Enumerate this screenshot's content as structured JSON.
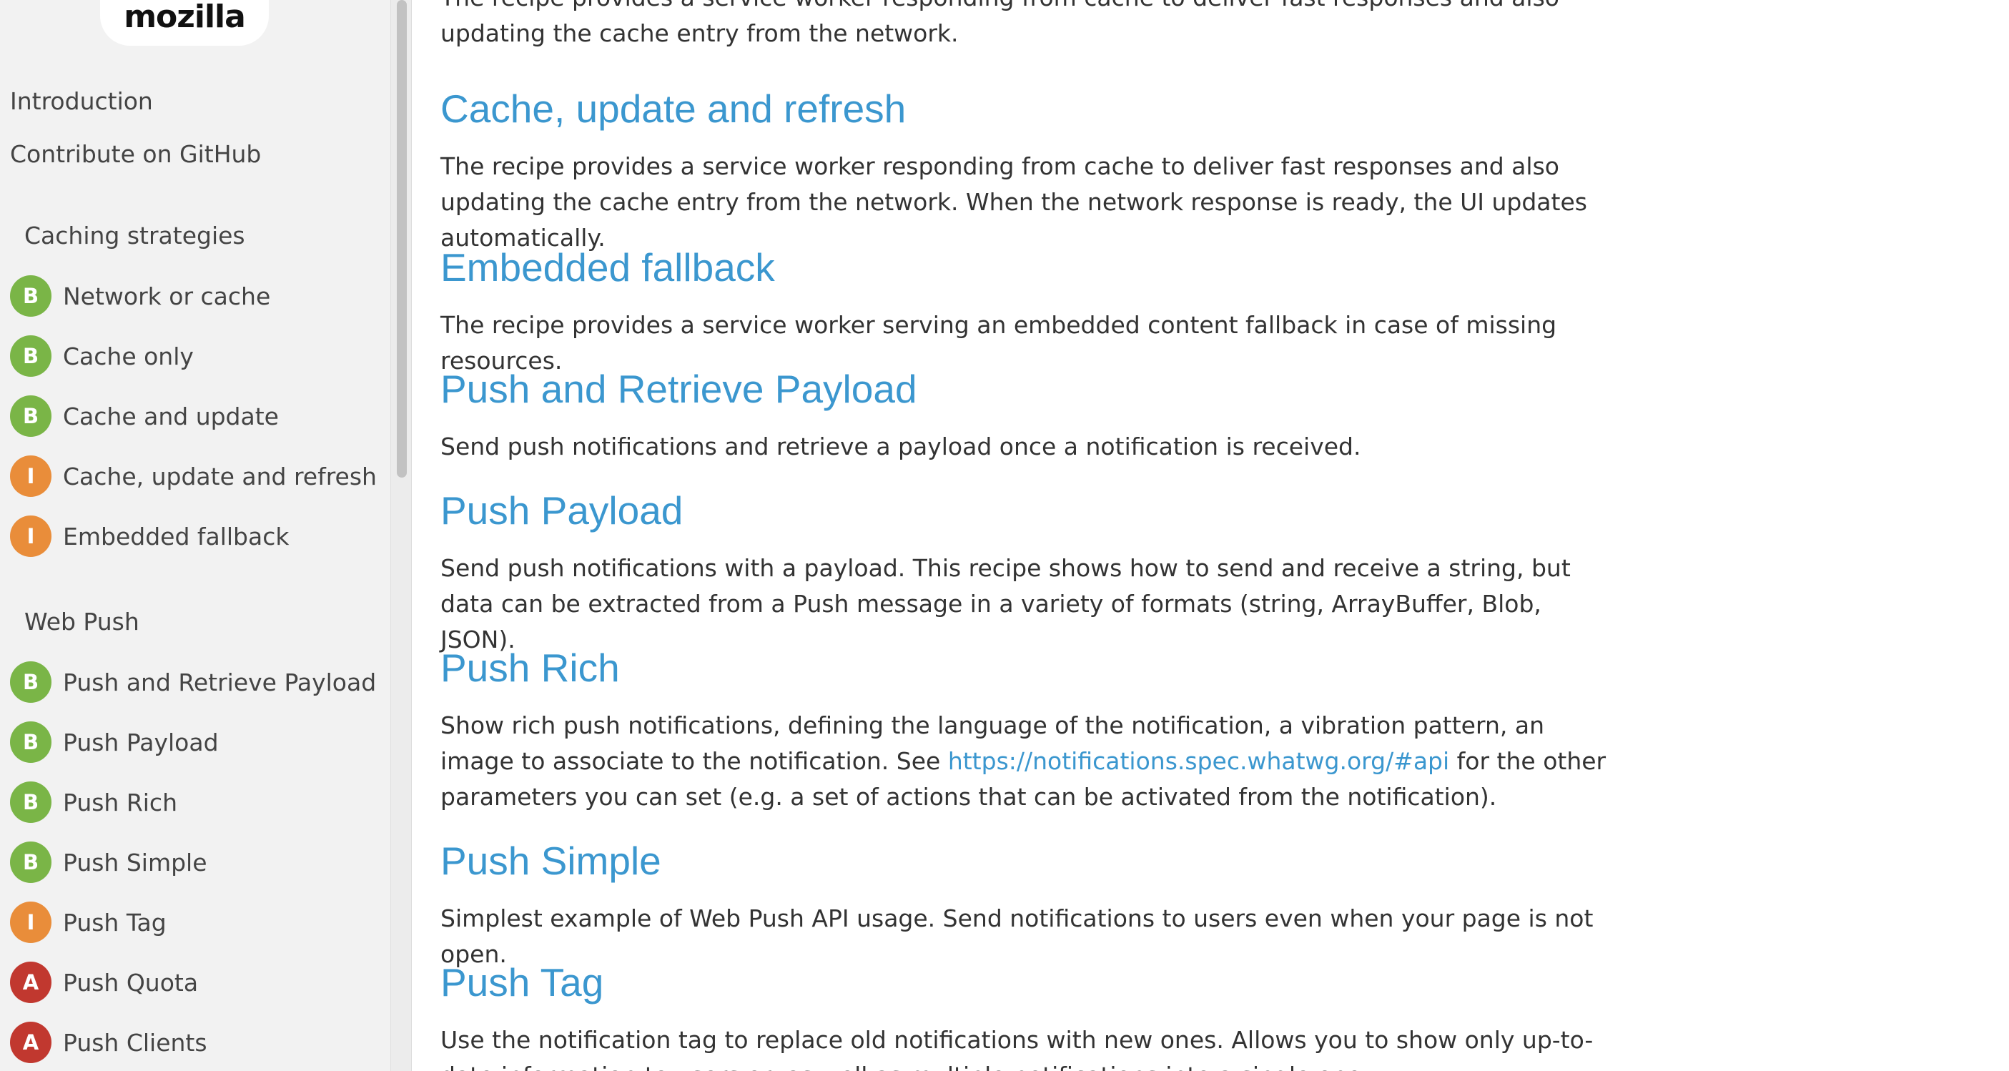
{
  "logo": "mozilla",
  "sidebar": {
    "top_links": [
      "Introduction",
      "Contribute on GitHub"
    ],
    "sections": [
      {
        "title": "Caching strategies",
        "items": [
          {
            "badge": "B",
            "level": "beginner",
            "label": "Network or cache"
          },
          {
            "badge": "B",
            "level": "beginner",
            "label": "Cache only"
          },
          {
            "badge": "B",
            "level": "beginner",
            "label": "Cache and update"
          },
          {
            "badge": "I",
            "level": "intermediate",
            "label": "Cache, update and refresh"
          },
          {
            "badge": "I",
            "level": "intermediate",
            "label": "Embedded fallback"
          }
        ]
      },
      {
        "title": "Web Push",
        "items": [
          {
            "badge": "B",
            "level": "beginner",
            "label": "Push and Retrieve Payload"
          },
          {
            "badge": "B",
            "level": "beginner",
            "label": "Push Payload"
          },
          {
            "badge": "B",
            "level": "beginner",
            "label": "Push Rich"
          },
          {
            "badge": "B",
            "level": "beginner",
            "label": "Push Simple"
          },
          {
            "badge": "I",
            "level": "intermediate",
            "label": "Push Tag"
          },
          {
            "badge": "A",
            "level": "advanced",
            "label": "Push Quota"
          },
          {
            "badge": "A",
            "level": "advanced",
            "label": "Push Clients"
          }
        ]
      }
    ]
  },
  "colors": {
    "beginner": "#7ab547",
    "intermediate": "#e98d3a",
    "advanced": "#c1382f",
    "link": "#3b97cf",
    "sidebar_bg": "#f2f2f2"
  },
  "main": {
    "intro_desc": "The recipe provides a service worker responding from cache to deliver fast responses and also updating the cache entry from the network.",
    "recipes": [
      {
        "title": "Cache, update and refresh",
        "desc": "The recipe provides a service worker responding from cache to deliver fast responses and also updating the cache entry from the network. When the network response is ready, the UI updates automatically."
      },
      {
        "title": "Embedded fallback",
        "desc": "The recipe provides a service worker serving an embedded content fallback in case of missing resources."
      },
      {
        "title": "Push and Retrieve Payload",
        "desc": "Send push notifications and retrieve a payload once a notification is received."
      },
      {
        "title": "Push Payload",
        "desc": "Send push notifications with a payload. This recipe shows how to send and receive a string, but data can be extracted from a Push message in a variety of formats (string, ArrayBuffer, Blob, JSON)."
      },
      {
        "title": "Push Rich",
        "desc_before": "Show rich push notifications, defining the language of the notification, a vibration pattern, an image to associate to the notification. See ",
        "desc_link": "https://notifications.spec.whatwg.org/#api",
        "desc_after": " for the other parameters you can set (e.g. a set of actions that can be activated from the notification)."
      },
      {
        "title": "Push Simple",
        "desc": "Simplest example of Web Push API usage. Send notifications to users even when your page is not open."
      },
      {
        "title": "Push Tag",
        "desc": "Use the notification tag to replace old notifications with new ones. Allows you to show only up-to-date information to users or, as well as multiple notifications into a single one."
      }
    ]
  }
}
